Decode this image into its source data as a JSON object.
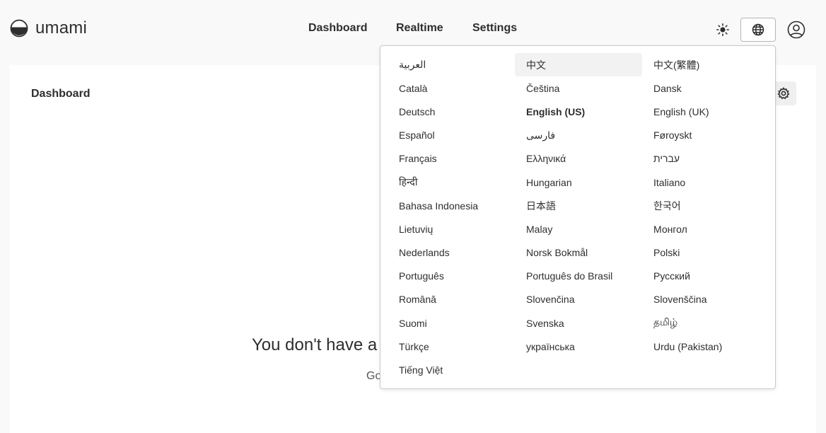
{
  "brand": {
    "name": "umami",
    "icon": "umami-logo-icon"
  },
  "nav": {
    "dashboard": "Dashboard",
    "realtime": "Realtime",
    "settings": "Settings"
  },
  "toolbar": {
    "theme_icon": "sun-icon",
    "language_icon": "globe-icon",
    "profile_icon": "user-circle-icon"
  },
  "panel": {
    "title": "Dashboard",
    "settings_icon": "gear-icon",
    "empty_title": "You don't have a",
    "empty_subtitle": "Go"
  },
  "language_menu": {
    "selected": "English (US)",
    "hovered": "中文",
    "items": [
      "العربية",
      "中文",
      "中文(繁體)",
      "Català",
      "Čeština",
      "Dansk",
      "Deutsch",
      "English (US)",
      "English (UK)",
      "Español",
      "فارسی",
      "Føroyskt",
      "Français",
      "Ελληνικά",
      "עברית",
      "हिन्दी",
      "Hungarian",
      "Italiano",
      "Bahasa Indonesia",
      "日本語",
      "한국어",
      "Lietuvių",
      "Malay",
      "Монгол",
      "Nederlands",
      "Norsk Bokmål",
      "Polski",
      "Português",
      "Português do Brasil",
      "Русский",
      "Română",
      "Slovenčina",
      "Slovenščina",
      "Suomi",
      "Svenska",
      "தமிழ்",
      "Türkçe",
      "українська",
      "Urdu (Pakistan)",
      "Tiếng Việt"
    ]
  },
  "colors": {
    "background": "#f9f9f9",
    "panel": "#ffffff",
    "text": "#2e2e2e",
    "border": "#c9c9c9",
    "hover": "#f2f2f2"
  }
}
